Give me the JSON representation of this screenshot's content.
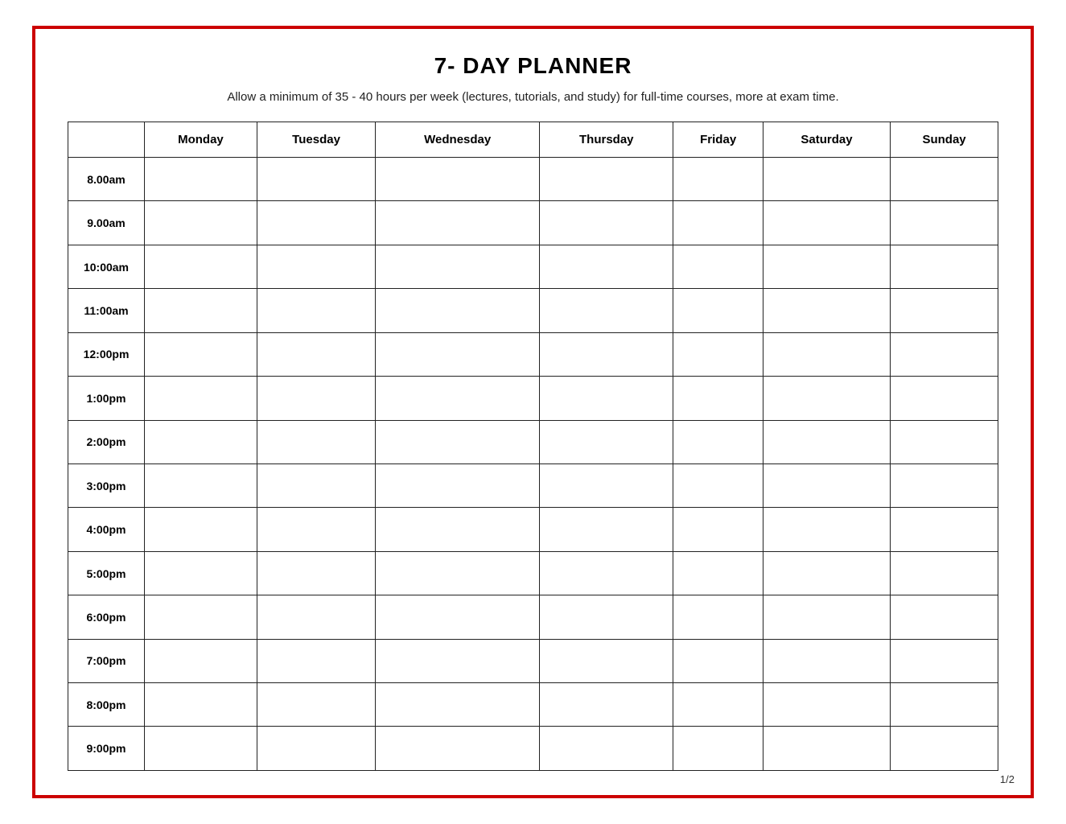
{
  "title": "7- DAY PLANNER",
  "subtitle": "Allow a minimum of 35 - 40 hours per week (lectures, tutorials, and study) for full-time courses, more at exam time.",
  "page_number": "1/2",
  "columns": {
    "time_header": "",
    "days": [
      "Monday",
      "Tuesday",
      "Wednesday",
      "Thursday",
      "Friday",
      "Saturday",
      "Sunday"
    ]
  },
  "time_slots": [
    "8.00am",
    "9.00am",
    "10:00am",
    "11:00am",
    "12:00pm",
    "1:00pm",
    "2:00pm",
    "3:00pm",
    "4:00pm",
    "5:00pm",
    "6:00pm",
    "7:00pm",
    "8:00pm",
    "9:00pm"
  ]
}
